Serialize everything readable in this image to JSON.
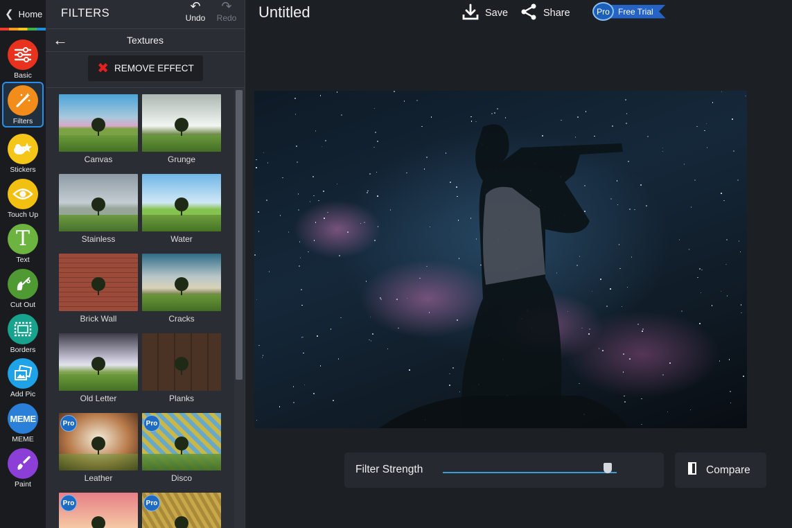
{
  "nav": {
    "home_label": "Home",
    "tools": [
      {
        "id": "basic",
        "label": "Basic",
        "color": "#e8321e"
      },
      {
        "id": "filters",
        "label": "Filters",
        "color": "#f28c1a",
        "active": true
      },
      {
        "id": "stickers",
        "label": "Stickers",
        "color": "#f5c518"
      },
      {
        "id": "touchup",
        "label": "Touch Up",
        "color": "#f2c011"
      },
      {
        "id": "text",
        "label": "Text",
        "color": "#6db33f"
      },
      {
        "id": "cutout",
        "label": "Cut Out",
        "color": "#4f9a32"
      },
      {
        "id": "borders",
        "label": "Borders",
        "color": "#18a38e"
      },
      {
        "id": "addpic",
        "label": "Add Pic",
        "color": "#1ea2e8"
      },
      {
        "id": "meme",
        "label": "MEME",
        "color": "#2a7fd9"
      },
      {
        "id": "paint",
        "label": "Paint",
        "color": "#8b3fd6"
      }
    ]
  },
  "panel": {
    "title": "FILTERS",
    "undo_label": "Undo",
    "redo_label": "Redo",
    "category": "Textures",
    "remove_label": "REMOVE EFFECT",
    "filters": [
      {
        "name": "Canvas",
        "pro": false
      },
      {
        "name": "Grunge",
        "pro": false
      },
      {
        "name": "Stainless",
        "pro": false
      },
      {
        "name": "Water",
        "pro": false
      },
      {
        "name": "Brick Wall",
        "pro": false
      },
      {
        "name": "Cracks",
        "pro": false
      },
      {
        "name": "Old Letter",
        "pro": false
      },
      {
        "name": "Planks",
        "pro": false
      },
      {
        "name": "Leather",
        "pro": true
      },
      {
        "name": "Disco",
        "pro": true
      },
      {
        "name": "",
        "pro": true
      },
      {
        "name": "",
        "pro": true
      }
    ],
    "pro_badge": "Pro"
  },
  "topbar": {
    "doc_title": "Untitled",
    "save_label": "Save",
    "share_label": "Share",
    "pro_label": "Pro",
    "trial_label": "Free Trial"
  },
  "controls": {
    "strength_label": "Filter Strength",
    "strength_value": 0.95,
    "compare_label": "Compare"
  }
}
